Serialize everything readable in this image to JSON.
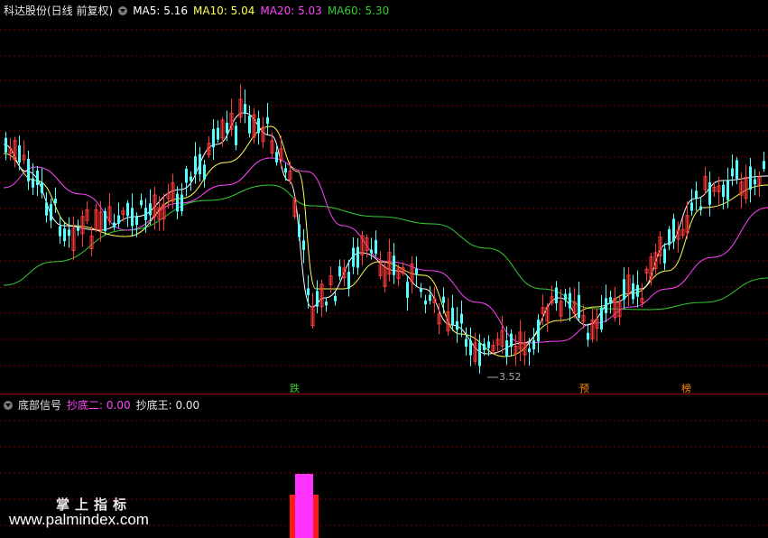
{
  "top_panel": {
    "title": "科达股份(日线 前复权)",
    "ma5": "MA5: 5.16",
    "ma10": "MA10: 5.04",
    "ma20": "MA20: 5.03",
    "ma60": "MA60: 5.30",
    "low_marker": "3.52",
    "signals": {
      "s1": "跌",
      "s2": "预",
      "s3": "榜"
    }
  },
  "bottom_panel": {
    "title": "底部信号",
    "ind1": "抄底二: 0.00",
    "ind2": "抄底王: 0.00"
  },
  "watermark": {
    "line1": "掌上指标",
    "line2": "www.palmindex.com"
  },
  "colors": {
    "up": "#ff3a3a",
    "down": "#54ffff",
    "ma5": "#ffffff",
    "ma10": "#ffff55",
    "ma20": "#ff44ff",
    "ma60": "#33cc33",
    "grid": "#7a0000",
    "signal_bar": "#ff33ff"
  }
}
